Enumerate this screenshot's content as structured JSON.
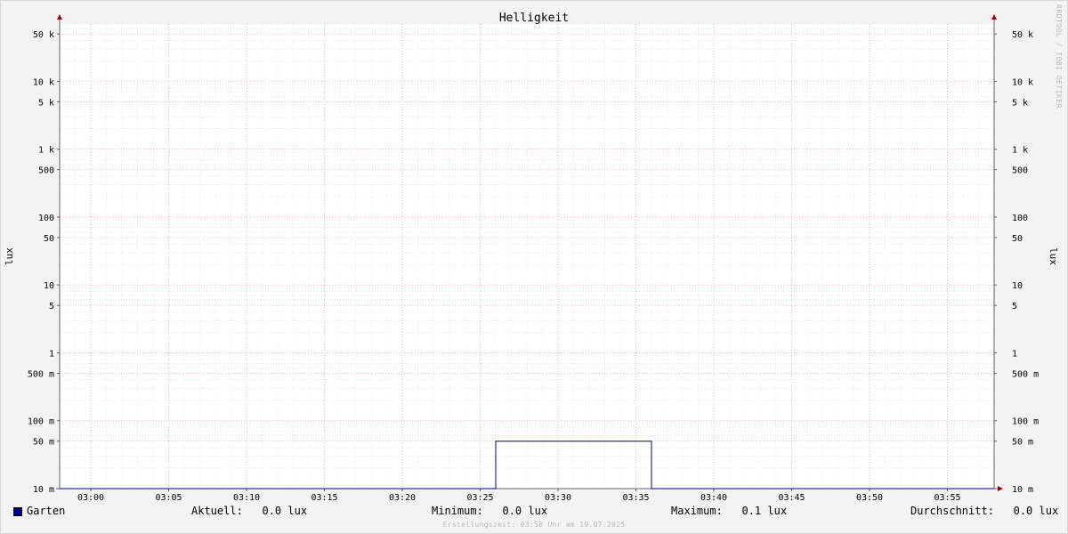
{
  "chart_data": {
    "type": "line",
    "title": "Helligkeit",
    "ylabel": "lux",
    "ylabel_right": "lux",
    "y_scale": "log",
    "ylim": [
      0.01,
      70000
    ],
    "y_ticks": [
      {
        "value": 50000,
        "label": "50 k"
      },
      {
        "value": 10000,
        "label": "10 k"
      },
      {
        "value": 5000,
        "label": "5 k"
      },
      {
        "value": 1000,
        "label": "1 k"
      },
      {
        "value": 500,
        "label": "500"
      },
      {
        "value": 100,
        "label": "100"
      },
      {
        "value": 50,
        "label": "50"
      },
      {
        "value": 10,
        "label": "10"
      },
      {
        "value": 5,
        "label": "5"
      },
      {
        "value": 1,
        "label": "1"
      },
      {
        "value": 0.5,
        "label": "500 m"
      },
      {
        "value": 0.1,
        "label": "100 m"
      },
      {
        "value": 0.05,
        "label": "50 m"
      },
      {
        "value": 0.01,
        "label": "10 m"
      }
    ],
    "x_start": "02:58",
    "x_end": "03:58",
    "x_ticks": [
      "03:00",
      "03:05",
      "03:10",
      "03:15",
      "03:20",
      "03:25",
      "03:30",
      "03:35",
      "03:40",
      "03:45",
      "03:50",
      "03:55"
    ],
    "grid": true,
    "series": [
      {
        "name": "Garten",
        "color": "#000080",
        "points": [
          {
            "x": "02:58",
            "y": 0.01
          },
          {
            "x": "03:26",
            "y": 0.01
          },
          {
            "x": "03:26",
            "y": 0.05
          },
          {
            "x": "03:36",
            "y": 0.05
          },
          {
            "x": "03:36",
            "y": 0.01
          },
          {
            "x": "03:58",
            "y": 0.01
          }
        ]
      }
    ]
  },
  "legend": {
    "series_name": "Garten",
    "swatch_color": "#000080",
    "current": "Aktuell:   0.0 lux",
    "minimum": "Minimum:   0.0 lux",
    "maximum": "Maximum:   0.1 lux",
    "average": "Durchschnitt:   0.0 lux"
  },
  "footer": "Erstellungszeit: 03:58 Uhr am 19.07.2025",
  "watermark": "RRDTOOL / TOBI OETIKER"
}
